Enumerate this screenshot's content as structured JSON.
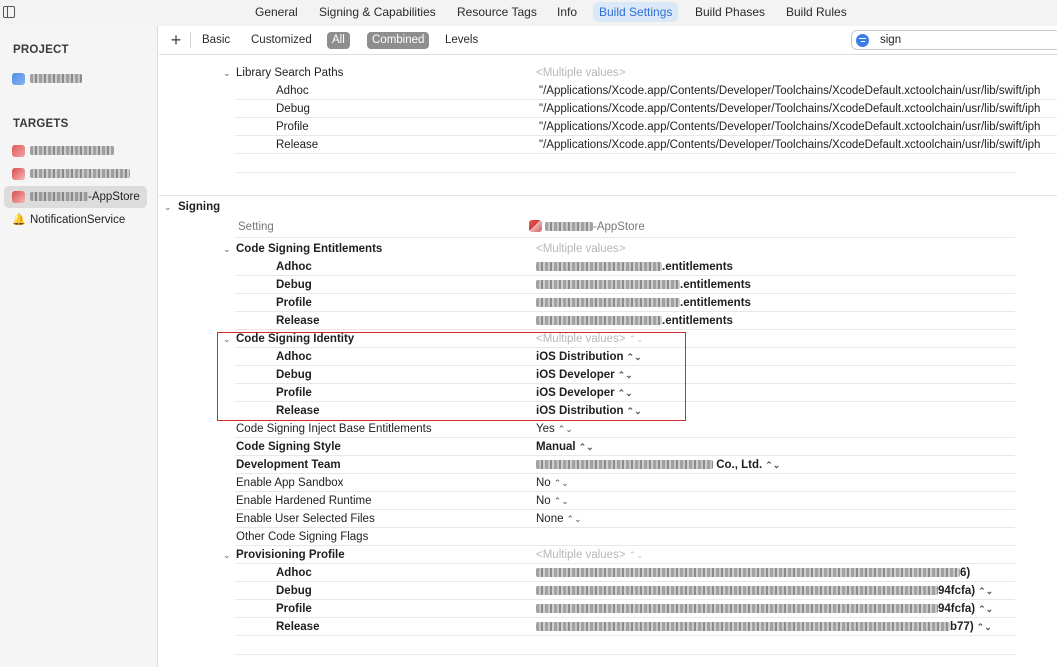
{
  "tabs": [
    {
      "label": "General",
      "active": false
    },
    {
      "label": "Signing & Capabilities",
      "active": false
    },
    {
      "label": "Resource Tags",
      "active": false
    },
    {
      "label": "Info",
      "active": false
    },
    {
      "label": "Build Settings",
      "active": true
    },
    {
      "label": "Build Phases",
      "active": false
    },
    {
      "label": "Build Rules",
      "active": false
    }
  ],
  "sidebar": {
    "project_header": "PROJECT",
    "targets_header": "TARGETS",
    "targets": [
      {
        "label": ""
      },
      {
        "label": ""
      },
      {
        "label": "-AppStore",
        "selected": true
      },
      {
        "label": "NotificationService"
      }
    ]
  },
  "filter": {
    "add_label": "+",
    "segments": [
      {
        "label": "Basic",
        "on": false
      },
      {
        "label": "Customized",
        "on": false
      },
      {
        "label": "All",
        "on": true
      },
      {
        "label": "Combined",
        "on": true
      },
      {
        "label": "Levels",
        "on": false
      }
    ],
    "search_value": "sign"
  },
  "library_search_paths": {
    "title": "Library Search Paths",
    "value": "<Multiple values>",
    "configs": [
      {
        "name": "Adhoc",
        "value": "\"/Applications/Xcode.app/Contents/Developer/Toolchains/XcodeDefault.xctoolchain/usr/lib/swift/iph"
      },
      {
        "name": "Debug",
        "value": "\"/Applications/Xcode.app/Contents/Developer/Toolchains/XcodeDefault.xctoolchain/usr/lib/swift/iph"
      },
      {
        "name": "Profile",
        "value": "\"/Applications/Xcode.app/Contents/Developer/Toolchains/XcodeDefault.xctoolchain/usr/lib/swift/iph"
      },
      {
        "name": "Release",
        "value": "\"/Applications/Xcode.app/Contents/Developer/Toolchains/XcodeDefault.xctoolchain/usr/lib/swift/iph"
      }
    ]
  },
  "signing": {
    "section_title": "Signing",
    "setting_header": "Setting",
    "target_header": "-AppStore",
    "entitlements": {
      "title": "Code Signing Entitlements",
      "value": "<Multiple values>",
      "configs": [
        {
          "name": "Adhoc",
          "value": ".entitlements"
        },
        {
          "name": "Debug",
          "value": ".entitlements"
        },
        {
          "name": "Profile",
          "value": ".entitlements"
        },
        {
          "name": "Release",
          "value": ".entitlements"
        }
      ]
    },
    "identity": {
      "title": "Code Signing Identity",
      "value": "<Multiple values>",
      "configs": [
        {
          "name": "Adhoc",
          "value": "iOS Distribution"
        },
        {
          "name": "Debug",
          "value": "iOS Developer"
        },
        {
          "name": "Profile",
          "value": "iOS Developer"
        },
        {
          "name": "Release",
          "value": "iOS Distribution"
        }
      ]
    },
    "settings": [
      {
        "label": "Code Signing Inject Base Entitlements",
        "value": "Yes",
        "bold": false,
        "stepper": true
      },
      {
        "label": "Code Signing Style",
        "value": "Manual",
        "bold": true,
        "stepper": true
      },
      {
        "label": "Development Team",
        "value": "Co., Ltd.",
        "bold": true,
        "stepper": true
      },
      {
        "label": "Enable App Sandbox",
        "value": "No",
        "bold": false,
        "stepper": true
      },
      {
        "label": "Enable Hardened Runtime",
        "value": "No",
        "bold": false,
        "stepper": true
      },
      {
        "label": "Enable User Selected Files",
        "value": "None",
        "bold": false,
        "stepper": true
      },
      {
        "label": "Other Code Signing Flags",
        "value": "",
        "bold": false,
        "stepper": false
      }
    ],
    "provisioning": {
      "title": "Provisioning Profile",
      "value": "<Multiple values>",
      "configs": [
        {
          "name": "Adhoc",
          "value": "6)"
        },
        {
          "name": "Debug",
          "value": "94fcfa)"
        },
        {
          "name": "Profile",
          "value": "94fcfa)"
        },
        {
          "name": "Release",
          "value": "b77)"
        }
      ]
    }
  },
  "icons": {
    "stepper": "⌃⌄",
    "chevron": "⌄"
  },
  "colors": {
    "accent": "#2f6fd6",
    "highlight_box": "#d22a2a",
    "multiple_values": "#b7b7b7"
  }
}
